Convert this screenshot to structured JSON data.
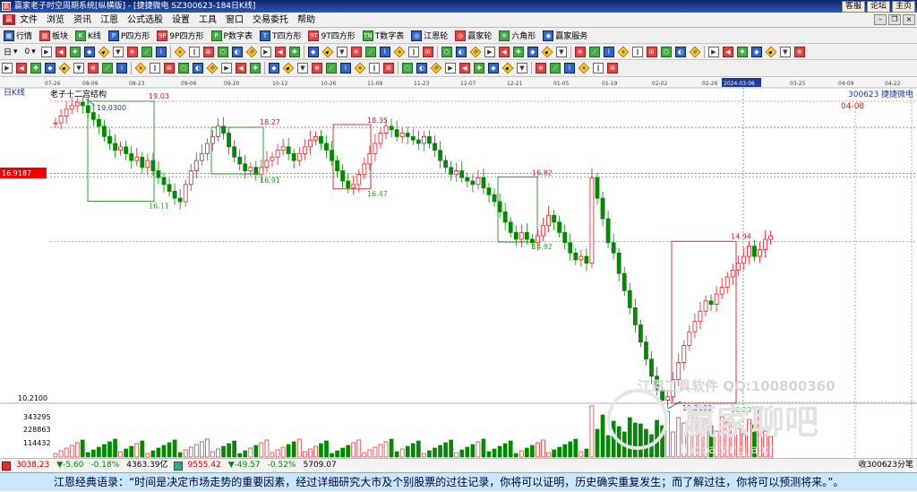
{
  "window": {
    "title": "赢家老子时空周期系统[纵横版] - [捷捷微电  SZ300623-184日K线]",
    "links": [
      "客服",
      "论坛",
      "主页"
    ],
    "app_icon": "赢"
  },
  "menu": [
    "文件",
    "浏览",
    "资讯",
    "江恩",
    "公式选股",
    "设置",
    "工具",
    "窗口",
    "交易委托",
    "帮助"
  ],
  "toolbar1": [
    {
      "icon": "grid-icon",
      "glyph": "▦",
      "label": "行情"
    },
    {
      "icon": "block-icon",
      "glyph": "▥",
      "label": "板块"
    },
    {
      "icon": "kline-icon",
      "glyph": "K",
      "label": "K线"
    },
    {
      "icon": "p-square-icon",
      "glyph": "P",
      "label": "P四方形"
    },
    {
      "icon": "9p-square-icon",
      "glyph": "9P",
      "label": "9P四方形"
    },
    {
      "icon": "p-number-icon",
      "glyph": "P",
      "label": "P数字表"
    },
    {
      "icon": "t-square-icon",
      "glyph": "T",
      "label": "T四方形"
    },
    {
      "icon": "9t-square-icon",
      "glyph": "9T",
      "label": "9T四方形"
    },
    {
      "icon": "t-number-icon",
      "glyph": "TN",
      "label": "T数字表"
    },
    {
      "icon": "gann-wheel-icon",
      "glyph": "◎",
      "label": "江恩轮"
    },
    {
      "icon": "yingjia-wheel-icon",
      "glyph": "◎",
      "label": "赢家轮"
    },
    {
      "icon": "hexagon-icon",
      "glyph": "✡",
      "label": "六角形"
    },
    {
      "icon": "service-icon",
      "glyph": "◉",
      "label": "赢家服务"
    }
  ],
  "toolbar2": {
    "period": "日",
    "count": "0",
    "tools": 52
  },
  "toolbar3": {
    "tools": 42
  },
  "chart": {
    "period_label": "日K线",
    "structure_label": "老子十二宫结构",
    "stock_code": "300623",
    "stock_name": "捷捷微电",
    "date_ticks": [
      "07-26",
      "08-09",
      "08-23",
      "09-06",
      "09-20",
      "10-12",
      "10-26",
      "11-09",
      "11-23",
      "12-07",
      "12-21",
      "01-05",
      "01-19",
      "02-02",
      "02-26",
      "2024-03-06",
      "03-25",
      "04-09",
      "04-22"
    ],
    "highlight_tick": "2024-03-06",
    "right_date": "04-08",
    "price_tag": "16.9187",
    "axis_value": "10.2100",
    "volume_ticks": [
      "343295",
      "228863",
      "114432"
    ],
    "annotations": [
      "19.03",
      "19.0300",
      "18.27",
      "18.35",
      "16.82",
      "16.91",
      "16.11",
      "16.47",
      "14.92",
      "14.94",
      "10.80",
      "10.2100"
    ],
    "watermark1": "江恩工具软件  QQ:100800360",
    "watermark2": "赢家聊吧",
    "watermark3": "liaoba.yingjia.cn",
    "colors": {
      "up": "#e0202a",
      "down": "#008a00",
      "box_green": "#2c8a2c",
      "box_red": "#cc2222",
      "axis": "#000000"
    }
  },
  "status": {
    "sh_index": "3038.23",
    "sh_change": "▼-5.60",
    "sh_pct": "-0.18%",
    "sh_amount": "4363.39亿",
    "sz_index": "9555.42",
    "sz_change": "▼-49.57",
    "sz_pct": "-0.52%",
    "sz_amount": "5709.07",
    "right": "收300623分笔"
  },
  "quote": "江恩经典语录：“时间是决定市场走势的重要因素，经过详细研究大市及个别股票的过往记录，你将可以证明，历史确实重复发生；而了解过往，你将可以预测将来。”。"
}
